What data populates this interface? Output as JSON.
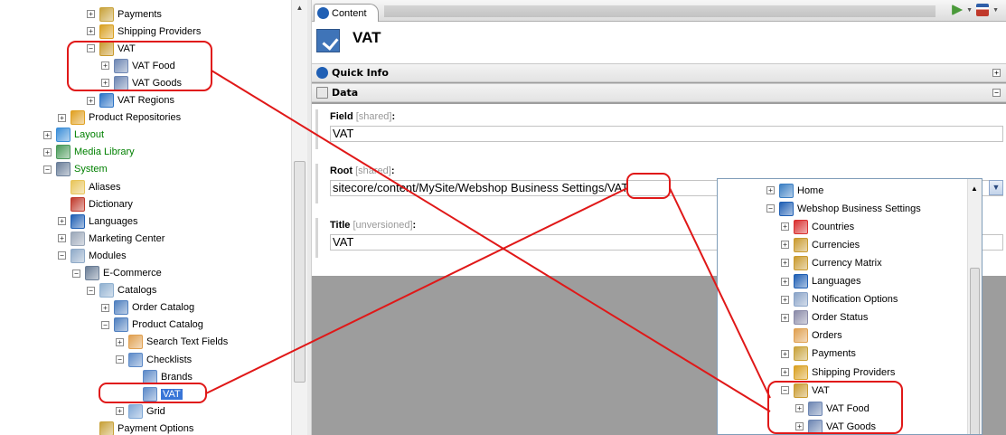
{
  "tree": {
    "items": [
      {
        "label": "Payments",
        "indent": 96,
        "expander": "+",
        "icon": "payments-icon",
        "color": "#c8a23a"
      },
      {
        "label": "Shipping Providers",
        "indent": 96,
        "expander": "+",
        "icon": "shipping-icon",
        "color": "#d9a020"
      },
      {
        "label": "VAT",
        "indent": 96,
        "expander": "−",
        "icon": "money-bag-icon",
        "color": "#c99a2e"
      },
      {
        "label": "VAT Food",
        "indent": 112,
        "expander": "+",
        "icon": "percent-icon",
        "color": "#6d86b3"
      },
      {
        "label": "VAT Goods",
        "indent": 112,
        "expander": "+",
        "icon": "percent-icon",
        "color": "#6d86b3"
      },
      {
        "label": "VAT Regions",
        "indent": 96,
        "expander": "+",
        "icon": "regions-icon",
        "color": "#2b73c6"
      },
      {
        "label": "Product Repositories",
        "indent": 64,
        "expander": "+",
        "icon": "box-icon",
        "color": "#e0a020"
      },
      {
        "label": "Layout",
        "indent": 48,
        "expander": "+",
        "icon": "layout-icon",
        "color": "#3b8ed8",
        "green": true
      },
      {
        "label": "Media Library",
        "indent": 48,
        "expander": "+",
        "icon": "media-icon",
        "color": "#4a9a5a",
        "green": true
      },
      {
        "label": "System",
        "indent": 48,
        "expander": "−",
        "icon": "system-icon",
        "color": "#6b7f9a",
        "green": true
      },
      {
        "label": "Aliases",
        "indent": 64,
        "expander": "",
        "icon": "folder-icon",
        "color": "#e8c55a"
      },
      {
        "label": "Dictionary",
        "indent": 64,
        "expander": "",
        "icon": "dictionary-icon",
        "color": "#c0392b"
      },
      {
        "label": "Languages",
        "indent": 64,
        "expander": "+",
        "icon": "languages-icon",
        "color": "#1f5fb4"
      },
      {
        "label": "Marketing Center",
        "indent": 64,
        "expander": "+",
        "icon": "marketing-icon",
        "color": "#9aa7b8"
      },
      {
        "label": "Modules",
        "indent": 64,
        "expander": "−",
        "icon": "modules-icon",
        "color": "#8faac8"
      },
      {
        "label": "E-Commerce",
        "indent": 80,
        "expander": "−",
        "icon": "ecommerce-icon",
        "color": "#6a7d96"
      },
      {
        "label": "Catalogs",
        "indent": 96,
        "expander": "−",
        "icon": "catalogs-icon",
        "color": "#8fb0d0"
      },
      {
        "label": "Order Catalog",
        "indent": 112,
        "expander": "+",
        "icon": "catalog-icon",
        "color": "#4f7fbf"
      },
      {
        "label": "Product Catalog",
        "indent": 112,
        "expander": "−",
        "icon": "catalog-icon",
        "color": "#4f7fbf"
      },
      {
        "label": "Search Text Fields",
        "indent": 128,
        "expander": "+",
        "icon": "grid-icon",
        "color": "#e0a050"
      },
      {
        "label": "Checklists",
        "indent": 128,
        "expander": "−",
        "icon": "checklist-icon",
        "color": "#5d8ac8"
      },
      {
        "label": "Brands",
        "indent": 144,
        "expander": "",
        "icon": "checklist-icon",
        "color": "#5d8ac8"
      },
      {
        "label": "VAT",
        "indent": 144,
        "expander": "",
        "icon": "checklist-icon",
        "color": "#5d8ac8",
        "selected": true
      },
      {
        "label": "Grid",
        "indent": 128,
        "expander": "+",
        "icon": "grid-icon",
        "color": "#7ea7d6"
      },
      {
        "label": "Payment Options",
        "indent": 96,
        "expander": "",
        "icon": "payments-icon",
        "color": "#c8a23a"
      }
    ]
  },
  "tab": {
    "label": "Content"
  },
  "item": {
    "title": "VAT"
  },
  "sections": {
    "quick_info": "Quick Info",
    "data": "Data",
    "toggle_collapsed": "+",
    "toggle_expanded": "−"
  },
  "fields": {
    "field": {
      "label": "Field",
      "qualifier": "[shared]",
      "colon": ":",
      "value": "VAT"
    },
    "root": {
      "label": "Root",
      "qualifier": "[shared]",
      "colon": ":",
      "value": "sitecore/content/MySite/Webshop Business Settings/VAT"
    },
    "title": {
      "label": "Title",
      "qualifier": "[unversioned]",
      "colon": ":",
      "value": "VAT"
    }
  },
  "dropdown": {
    "items": [
      {
        "label": "Home",
        "indent": 54,
        "expander": "+",
        "icon": "home-icon",
        "color": "#3b7fc4"
      },
      {
        "label": "Webshop Business Settings",
        "indent": 54,
        "expander": "−",
        "icon": "settings-icon",
        "color": "#1f5fb4"
      },
      {
        "label": "Countries",
        "indent": 70,
        "expander": "+",
        "icon": "flag-icon",
        "color": "#d93030"
      },
      {
        "label": "Currencies",
        "indent": 70,
        "expander": "+",
        "icon": "money-bag-icon",
        "color": "#c99a2e"
      },
      {
        "label": "Currency Matrix",
        "indent": 70,
        "expander": "+",
        "icon": "money-bag-icon",
        "color": "#c99a2e"
      },
      {
        "label": "Languages",
        "indent": 70,
        "expander": "+",
        "icon": "languages-icon",
        "color": "#1f5fb4"
      },
      {
        "label": "Notification Options",
        "indent": 70,
        "expander": "+",
        "icon": "notification-icon",
        "color": "#8aa4c8"
      },
      {
        "label": "Order Status",
        "indent": 70,
        "expander": "+",
        "icon": "hourglass-icon",
        "color": "#8a8aa8"
      },
      {
        "label": "Orders",
        "indent": 70,
        "expander": "",
        "icon": "grid-icon",
        "color": "#e0a050"
      },
      {
        "label": "Payments",
        "indent": 70,
        "expander": "+",
        "icon": "payments-icon",
        "color": "#c8a23a"
      },
      {
        "label": "Shipping Providers",
        "indent": 70,
        "expander": "+",
        "icon": "shipping-icon",
        "color": "#d9a020"
      },
      {
        "label": "VAT",
        "indent": 70,
        "expander": "−",
        "icon": "money-bag-icon",
        "color": "#c99a2e"
      },
      {
        "label": "VAT Food",
        "indent": 86,
        "expander": "+",
        "icon": "percent-icon",
        "color": "#6d86b3"
      },
      {
        "label": "VAT Goods",
        "indent": 86,
        "expander": "+",
        "icon": "percent-icon",
        "color": "#6d86b3"
      }
    ]
  },
  "annotation_color": "#e01818"
}
